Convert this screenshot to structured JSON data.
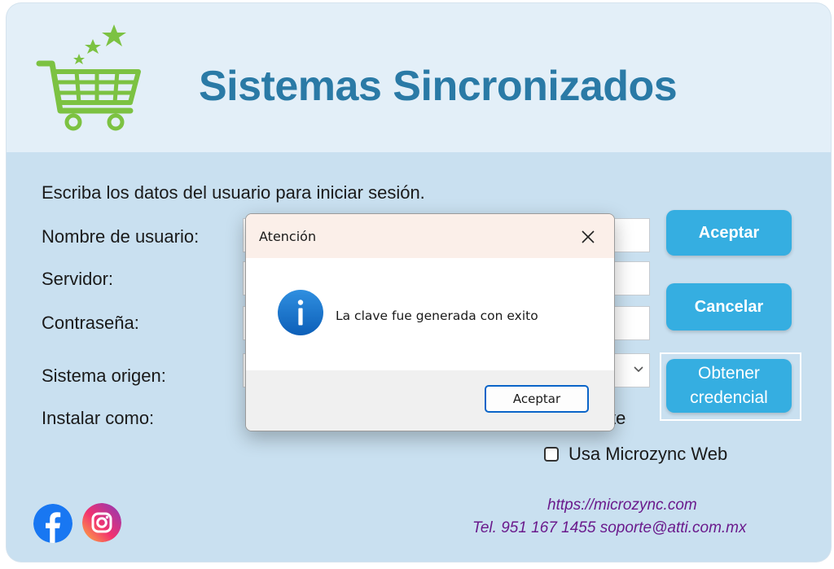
{
  "app": {
    "title": "Sistemas Sincronizados"
  },
  "form": {
    "instructions": "Escriba los datos del usuario para iniciar sesión.",
    "labels": {
      "username": "Nombre de usuario:",
      "server": "Servidor:",
      "password": "Contraseña:",
      "origin_system": "Sistema origen:",
      "install_as": "Instalar como:"
    },
    "partial_option_text": "te",
    "checkbox_web": {
      "label": "Usa Microzync Web",
      "checked": false
    }
  },
  "buttons": {
    "accept": "Aceptar",
    "cancel": "Cancelar",
    "credential_line1": "Obtener",
    "credential_line2": "credencial"
  },
  "footer": {
    "url": "https://microzync.com",
    "contact": "Tel. 951 167 1455  soporte@atti.com.mx",
    "social_icons": [
      "facebook-icon",
      "instagram-icon"
    ]
  },
  "dialog": {
    "title": "Atención",
    "message": "La clave fue generada con exito",
    "ok_label": "Aceptar",
    "icon": "info-icon"
  },
  "colors": {
    "brand_blue": "#2a7aa6",
    "button_blue": "#35aee1",
    "cart_green": "#7cc242",
    "link_purple": "#6a1a8c"
  }
}
